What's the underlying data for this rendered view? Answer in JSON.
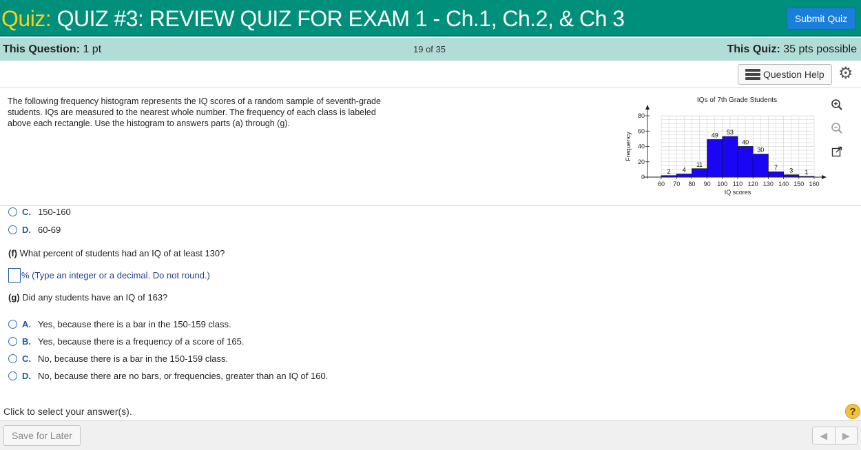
{
  "header": {
    "quiz_prefix": "Quiz:",
    "quiz_title": "QUIZ #3: REVIEW QUIZ FOR EXAM 1 - Ch.1, Ch.2, & Ch 3",
    "submit_label": "Submit Quiz"
  },
  "info": {
    "question_label": "This Question:",
    "question_points": "1 pt",
    "progress": "19 of 35",
    "quiz_label": "This Quiz:",
    "quiz_points": "35 pts possible"
  },
  "toolbar": {
    "help_label": "Question Help"
  },
  "question": {
    "intro": "The following frequency histogram represents the IQ scores of a random sample of seventh-grade students. IQs are measured to the nearest whole number. The frequency of each class is labeled above each rectangle. Use the histogram to answers parts (a) through (g)."
  },
  "chart_data": {
    "type": "bar",
    "title": "IQs of 7th Grade Students",
    "xlabel": "IQ scores",
    "ylabel": "Frequency",
    "bin_edges": [
      60,
      70,
      80,
      90,
      100,
      110,
      120,
      130,
      140,
      150,
      160
    ],
    "x_ticks": [
      "60",
      "70",
      "80",
      "90",
      "100",
      "110",
      "120",
      "130",
      "140",
      "150",
      "160"
    ],
    "values": [
      2,
      4,
      11,
      49,
      53,
      40,
      30,
      7,
      3,
      1
    ],
    "y_ticks": [
      "0",
      "20",
      "40",
      "60",
      "80"
    ],
    "ylim": [
      0,
      80
    ],
    "grid": true,
    "bar_color": "#1a06f5"
  },
  "part_e_options": [
    {
      "letter": "C.",
      "text": "150-160"
    },
    {
      "letter": "D.",
      "text": "60-69"
    }
  ],
  "part_f": {
    "label": "(f)",
    "text": "What percent of students had an IQ of at least 130?",
    "hint": "% (Type an integer or a decimal. Do not round.)"
  },
  "part_g": {
    "label": "(g)",
    "text": "Did any students have an IQ of 163?",
    "options": [
      {
        "letter": "A.",
        "text": "Yes, because there is a bar in the 150-159 class."
      },
      {
        "letter": "B.",
        "text": "Yes, because there is a frequency of a score of 165."
      },
      {
        "letter": "C.",
        "text": "No, because there is a bar in the 150-159 class."
      },
      {
        "letter": "D.",
        "text": "No, because there are no bars, or frequencies, greater than an IQ of 160."
      }
    ]
  },
  "footer": {
    "instruction": "Click to select your answer(s).",
    "save_label": "Save for Later",
    "help_mark": "?"
  },
  "colors": {
    "header": "#008f7a",
    "info_bar": "#b2ddd7",
    "accent": "#1a7fd9",
    "prefix": "#f6d21a"
  }
}
